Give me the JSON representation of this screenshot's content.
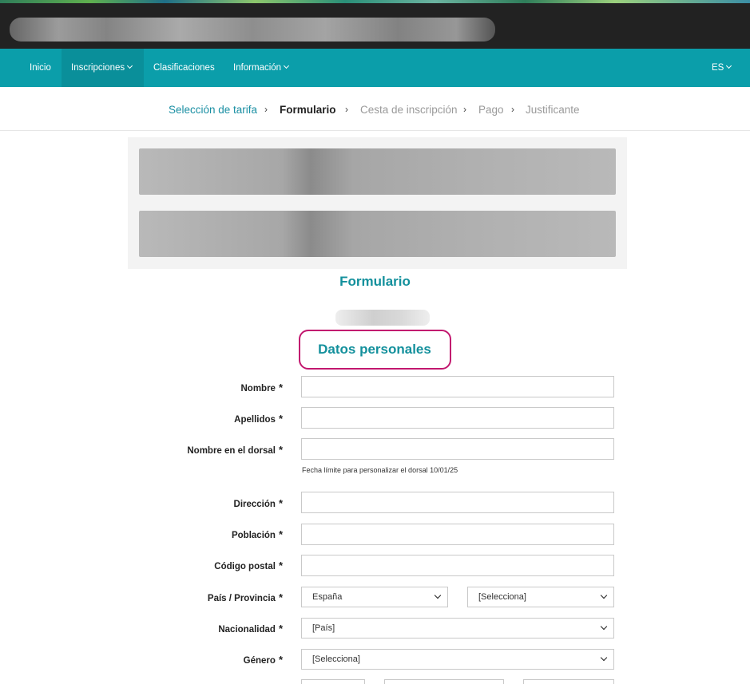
{
  "nav": {
    "items": [
      "Inicio",
      "Inscripciones",
      "Clasificaciones",
      "Información"
    ],
    "lang": "ES"
  },
  "breadcrumb": {
    "steps": [
      "Selección de tarifa",
      "Formulario",
      "Cesta de inscripción",
      "Pago",
      "Justificante"
    ],
    "sep": "›"
  },
  "page": {
    "title": "Formulario",
    "section": "Datos personales"
  },
  "form": {
    "star": "*",
    "labels": {
      "nombre": "Nombre",
      "apellidos": "Apellidos",
      "dorsal": "Nombre en el dorsal",
      "direccion": "Dirección",
      "poblacion": "Población",
      "cp": "Código postal",
      "pais": "País / Provincia",
      "nacionalidad": "Nacionalidad",
      "genero": "Género"
    },
    "dorsal_hint": "Fecha límite para personalizar el dorsal 10/01/25",
    "selects": {
      "pais": "España",
      "provincia": "[Selecciona]",
      "nacionalidad": "[País]",
      "genero": "[Selecciona]"
    }
  }
}
